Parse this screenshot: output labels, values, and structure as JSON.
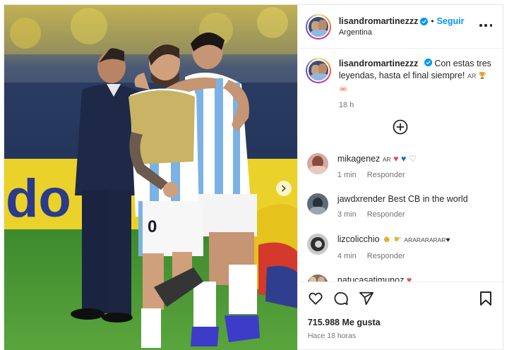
{
  "header": {
    "username": "lisandromartinezzz",
    "follow_label": "Seguir",
    "location": "Argentina",
    "separator": "•"
  },
  "caption": {
    "username": "lisandromartinezzz",
    "text": "Con estas tres leyendas, hasta el final siempre!",
    "flag": "AR",
    "time": "18 h"
  },
  "comments": [
    {
      "username": "mikagenez",
      "text": "",
      "flag": "AR",
      "time": "1 min",
      "reply_label": "Responder"
    },
    {
      "username": "jawdxrender",
      "text": "Best CB in the world",
      "time": "3 min",
      "reply_label": "Responder"
    },
    {
      "username": "lizcolicchio",
      "text": "",
      "flag_text": "ARARARARAR",
      "time": "4 min",
      "reply_label": "Responder"
    },
    {
      "username": "natucasatimunoz",
      "text": ""
    }
  ],
  "footer": {
    "likes": "715.988 Me gusta",
    "posted_ago": "Hace 18 horas"
  },
  "photo": {
    "jersey_number": "0"
  },
  "icons": [
    "verified-icon",
    "more-icon",
    "add-comment-icon",
    "heart-icon",
    "comment-icon",
    "share-icon",
    "save-icon",
    "next-arrow-icon"
  ],
  "colors": {
    "accent": "#0095f6",
    "heart": "#ed4956",
    "muted": "#737373"
  }
}
